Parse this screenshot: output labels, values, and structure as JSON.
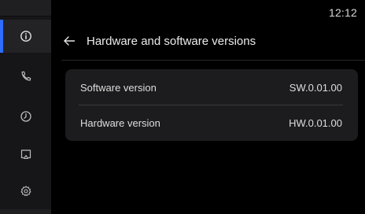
{
  "status_bar": {
    "time": "12:12"
  },
  "header": {
    "title": "Hardware and software versions",
    "back_icon": "arrow-left-icon"
  },
  "sidebar": {
    "items": [
      {
        "icon": "info-icon",
        "active": true
      },
      {
        "icon": "phone-icon",
        "active": false
      },
      {
        "icon": "clock-icon",
        "active": false
      },
      {
        "icon": "screen-cast-icon",
        "active": false
      },
      {
        "icon": "gear-icon",
        "active": false
      }
    ]
  },
  "versions": [
    {
      "label": "Software version",
      "value": "SW.0.01.00"
    },
    {
      "label": "Hardware version",
      "value": "HW.0.01.00"
    }
  ],
  "colors": {
    "accent": "#2f6dff",
    "background": "#000000",
    "card": "#1c1c1e",
    "rail": "#161618"
  }
}
